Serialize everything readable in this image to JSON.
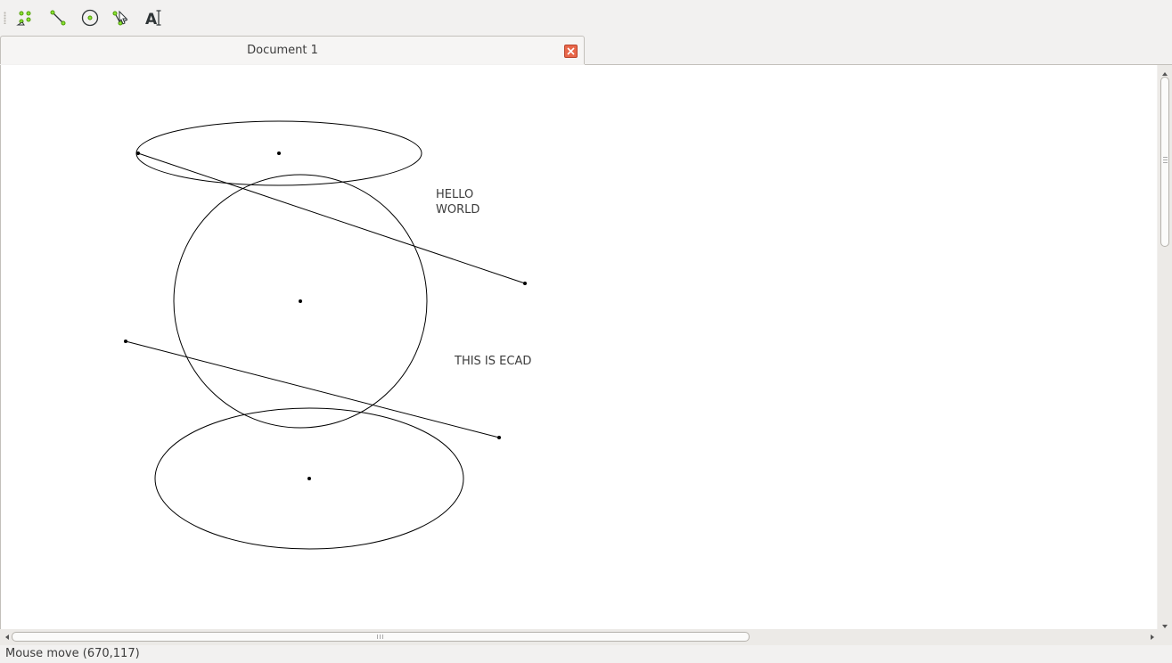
{
  "toolbar": {
    "tools": [
      {
        "name": "points-tool",
        "icon": "points-icon"
      },
      {
        "name": "line-tool",
        "icon": "line-icon"
      },
      {
        "name": "circle-tool",
        "icon": "circle-icon"
      },
      {
        "name": "select-tool",
        "icon": "select-arrow-icon"
      },
      {
        "name": "text-tool",
        "icon": "text-icon",
        "glyph": "A"
      }
    ],
    "icon_color": "#4e9a06"
  },
  "tabs": [
    {
      "label": "Document 1",
      "active": true
    }
  ],
  "drawing": {
    "texts": [
      {
        "lines": [
          "HELLO",
          "WORLD"
        ]
      },
      {
        "lines": [
          "THIS IS ECAD"
        ]
      }
    ]
  },
  "status": {
    "message": "Mouse move (670,117)"
  },
  "colors": {
    "window_bg": "#f2f1f0",
    "canvas_bg": "#ffffff",
    "stroke": "#000000",
    "tab_close": "#e8674a"
  }
}
